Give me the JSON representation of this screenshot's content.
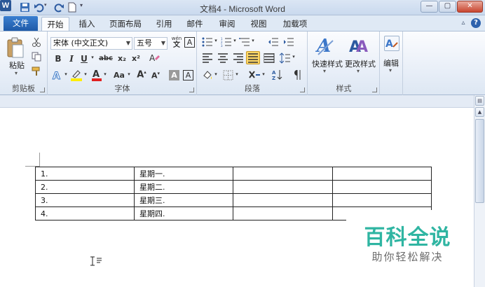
{
  "window": {
    "title": "文档4  -  Microsoft Word",
    "app_icon": "W",
    "minimize": "—",
    "maximize": "▢",
    "close": "✕"
  },
  "tabs": {
    "file": "文件",
    "items": [
      {
        "label": "开始",
        "active": true
      },
      {
        "label": "插入"
      },
      {
        "label": "页面布局"
      },
      {
        "label": "引用"
      },
      {
        "label": "邮件"
      },
      {
        "label": "审阅"
      },
      {
        "label": "视图"
      },
      {
        "label": "加载项"
      }
    ]
  },
  "ribbon": {
    "clipboard": {
      "label": "剪贴板",
      "paste": "粘贴"
    },
    "font": {
      "label": "字体",
      "font_name": "宋体 (中文正文)",
      "font_size": "五号",
      "bold": "B",
      "italic": "I",
      "underline": "U",
      "strike": "abc",
      "subscript": "x₂",
      "superscript": "x²",
      "grow": "A",
      "shrink": "A",
      "change_case": "Aa",
      "char_border": "A",
      "char_shading": "A",
      "phonetic": "wén",
      "clear": "A"
    },
    "paragraph": {
      "label": "段落"
    },
    "styles": {
      "label": "样式",
      "quick_styles": "快速样式",
      "change_styles": "更改样式"
    },
    "editing": {
      "label": "编辑"
    }
  },
  "document": {
    "table": [
      [
        "1.",
        "星期一.",
        "",
        ""
      ],
      [
        "2.",
        "星期二.",
        "",
        ""
      ],
      [
        "3.",
        "星期三.",
        "",
        ""
      ],
      [
        "4.",
        "星期四.",
        "",
        ""
      ]
    ]
  },
  "watermark": {
    "title": "百科全说",
    "subtitle": "助你轻松解决"
  },
  "colors": {
    "accent": "#2b579a",
    "file_tab": "#2a6bc2",
    "watermark": "#2fb5a2"
  }
}
